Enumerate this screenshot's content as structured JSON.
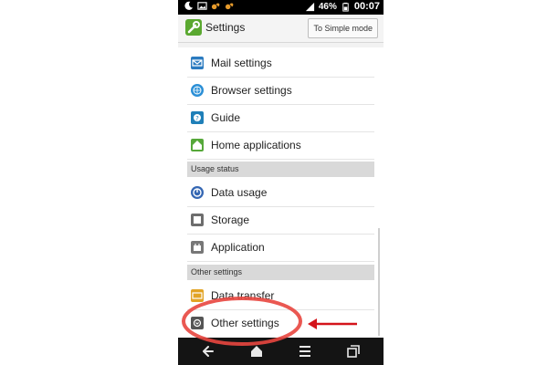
{
  "statusbar": {
    "icons_left": [
      "moon-icon",
      "image-icon",
      "squirrel-icon",
      "squirrel-icon"
    ],
    "battery_percent": "46%",
    "time": "00:07"
  },
  "header": {
    "title": "Settings",
    "simple_mode_button": "To Simple mode"
  },
  "list": {
    "items_top": [
      {
        "label": "Mail settings",
        "icon": "mail-icon",
        "color": "#2b7bc0"
      },
      {
        "label": "Browser settings",
        "icon": "globe-icon",
        "color": "#2b8fd6"
      },
      {
        "label": "Guide",
        "icon": "guide-icon",
        "color": "#1f7fb8"
      },
      {
        "label": "Home applications",
        "icon": "home-icon",
        "color": "#56a83a"
      }
    ],
    "section_usage": "Usage status",
    "items_usage": [
      {
        "label": "Data usage",
        "icon": "data-usage-icon",
        "color": "#3567b3"
      },
      {
        "label": "Storage",
        "icon": "storage-icon",
        "color": "#6d6d6d"
      },
      {
        "label": "Application",
        "icon": "application-icon",
        "color": "#777777"
      }
    ],
    "section_other": "Other settings",
    "items_other": [
      {
        "label": "Data transfer",
        "icon": "data-transfer-icon",
        "color": "#e2a425"
      },
      {
        "label": "Other settings",
        "icon": "other-settings-icon",
        "color": "#555555"
      }
    ]
  },
  "navbar": {
    "buttons": [
      "back-icon",
      "home-icon",
      "menu-icon",
      "recent-apps-icon"
    ]
  },
  "annotation": {
    "circle_color": "#e8463f",
    "arrow_color": "#d4141b"
  }
}
